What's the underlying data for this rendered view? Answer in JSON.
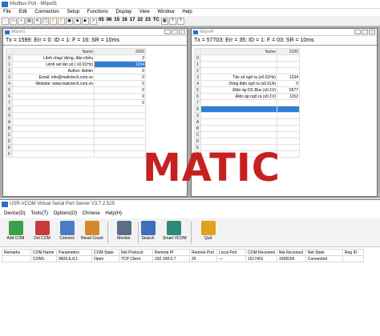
{
  "app": {
    "title": "Modbus Poll - Mbpoll1",
    "menu": [
      "File",
      "Edit",
      "Connection",
      "Setup",
      "Functions",
      "Display",
      "View",
      "Window",
      "Help"
    ],
    "toolbar_codes": [
      "05",
      "06",
      "15",
      "16",
      "17",
      "22",
      "23",
      "TC"
    ]
  },
  "win1": {
    "title": "Mbpoll1",
    "status": "Tx = 1599: Err = 0: ID = 1: F = 16: SR = 10ms",
    "header_name": "Name",
    "header_addr": "2000",
    "rows": [
      {
        "idx": "0",
        "name": "Lệnh chạy/ dừng, đảo chiều",
        "val": "2",
        "sel": false
      },
      {
        "idx": "1",
        "name": "Lệnh set tần số ( x0.01Hz)",
        "val": "1234",
        "sel": true
      },
      {
        "idx": "2",
        "name": "Author: Admin",
        "val": "0",
        "sel": false
      },
      {
        "idx": "3",
        "name": "Email: info@matictech.com.vn",
        "val": "0",
        "sel": false
      },
      {
        "idx": "4",
        "name": "Website: www.matictech.com.vn",
        "val": "0",
        "sel": false
      },
      {
        "idx": "5",
        "name": "",
        "val": "0",
        "sel": false
      },
      {
        "idx": "6",
        "name": "",
        "val": "0",
        "sel": false
      },
      {
        "idx": "7",
        "name": "",
        "val": "0",
        "sel": false
      },
      {
        "idx": "8",
        "name": "",
        "val": "",
        "sel": false
      },
      {
        "idx": "9",
        "name": "",
        "val": "",
        "sel": false
      },
      {
        "idx": "A",
        "name": "",
        "val": "",
        "sel": false
      },
      {
        "idx": "B",
        "name": "",
        "val": "",
        "sel": false
      },
      {
        "idx": "C",
        "name": "",
        "val": "",
        "sel": false
      },
      {
        "idx": "D",
        "name": "",
        "val": "",
        "sel": false
      },
      {
        "idx": "E",
        "name": "",
        "val": "",
        "sel": false
      },
      {
        "idx": "F",
        "name": "",
        "val": "",
        "sel": false
      }
    ]
  },
  "win2": {
    "title": "Mbpoll4",
    "status": "Tx = 57703: Err = 35: ID = 1: F = 03: SR = 10ms",
    "header_name": "Name",
    "header_addr": "2100",
    "rows": [
      {
        "idx": "0",
        "name": "",
        "val": "",
        "sel": false
      },
      {
        "idx": "1",
        "name": "",
        "val": "",
        "sel": false
      },
      {
        "idx": "2",
        "name": "",
        "val": "",
        "sel": false
      },
      {
        "idx": "3",
        "name": "Tần số ngõ ra (x0.01Hz)",
        "val": "1234",
        "sel": false
      },
      {
        "idx": "4",
        "name": "Dòng điện ngõ ra (x0.01A)",
        "val": "0",
        "sel": false
      },
      {
        "idx": "5",
        "name": "Điện áp DC-Bus (x0.1V)",
        "val": "5577",
        "sel": false
      },
      {
        "idx": "6",
        "name": "Điện áp ngõ ra (x0.1V)",
        "val": "1152",
        "sel": false
      },
      {
        "idx": "7",
        "name": "",
        "val": "",
        "sel": false
      },
      {
        "idx": "8",
        "name": "",
        "val": "",
        "sel": true
      },
      {
        "idx": "9",
        "name": "",
        "val": "",
        "sel": false
      },
      {
        "idx": "A",
        "name": "",
        "val": "",
        "sel": false
      },
      {
        "idx": "B",
        "name": "",
        "val": "",
        "sel": false
      },
      {
        "idx": "C",
        "name": "",
        "val": "",
        "sel": false
      },
      {
        "idx": "D",
        "name": "",
        "val": "",
        "sel": false
      },
      {
        "idx": "E",
        "name": "",
        "val": "",
        "sel": false
      },
      {
        "idx": "F",
        "name": "",
        "val": "",
        "sel": false
      }
    ]
  },
  "watermark": "MATIC",
  "usr": {
    "title": "USR-VCOM Virtual Serial Port Server V3.7.2.525",
    "menu": [
      "Device(D)",
      "Tools(T)",
      "Options(O)",
      "Chinese",
      "Help(H)"
    ],
    "buttons": {
      "add": "Add COM",
      "del": "Del COM",
      "connect": "Connect",
      "reset": "Reset Count",
      "monitor": "Monitor",
      "search": "Search",
      "smart": "Smart VCOM",
      "quit": "Quit"
    },
    "columns": [
      "Remarks",
      "COM Name",
      "Parameters",
      "COM State",
      "Net Protocol",
      "Remote IP",
      "Remote Port",
      "Local Port",
      "COM Received",
      "Net Received",
      "Net State",
      "Reg ID"
    ],
    "row": [
      "",
      "COM1",
      "9600,E,8,1",
      "Open",
      "TCP Client",
      "192.168.0.7",
      "26",
      "—",
      "1617401",
      "1568166",
      "Connected",
      ""
    ]
  },
  "colors": {
    "selection": "#2f7fd6",
    "mdi_bg": "#ababab",
    "watermark": "#c62020"
  }
}
